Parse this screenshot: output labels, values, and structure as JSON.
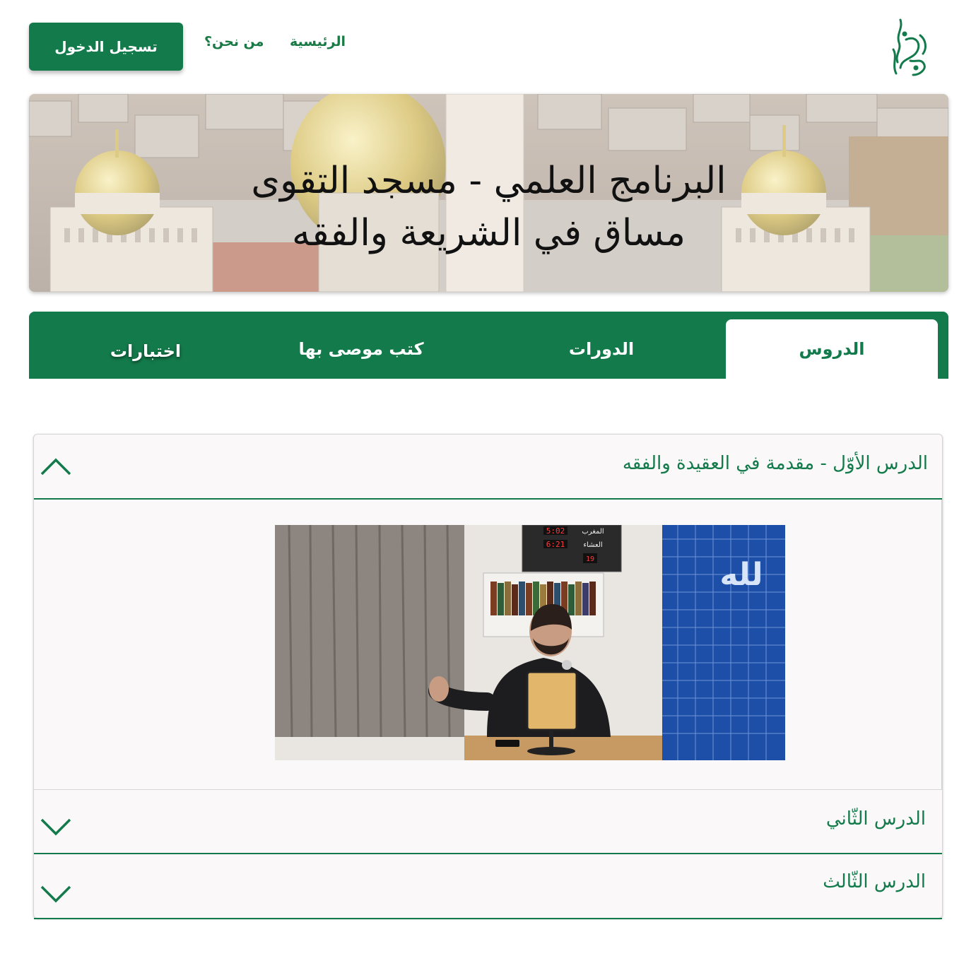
{
  "header": {
    "login_label": "تسجيل الدخول",
    "nav": [
      {
        "label": "من نحن؟"
      },
      {
        "label": "الرئيسية"
      }
    ],
    "logo_icon": "mosque-calligraphy-logo"
  },
  "hero": {
    "title_line1": "البرنامج العلمي - مسجد التقوى",
    "title_line2": "مساق في الشريعة والفقه"
  },
  "tabs": [
    {
      "label": "الدروس",
      "active": true
    },
    {
      "label": "الدورات",
      "active": false
    },
    {
      "label": "كتب موصى بها",
      "active": false
    },
    {
      "label": "اختبارات",
      "active": false
    }
  ],
  "lessons": [
    {
      "title": "الدرس الأوّل - مقدمة في العقيدة والفقه",
      "expanded": true
    },
    {
      "title": "الدرس الثّاني",
      "expanded": false
    },
    {
      "title": "الدرس الثّالث",
      "expanded": false
    }
  ],
  "video": {
    "clock_maghrib_time": "5:02",
    "clock_isha_time": "6:21",
    "clock_counter": "19",
    "clock_label_maghrib": "المغرب",
    "clock_label_isha": "العشاء",
    "wall_calligraphy": "لله"
  },
  "colors": {
    "brand_green": "#137a4b",
    "tile_blue": "#1d4fa8"
  }
}
